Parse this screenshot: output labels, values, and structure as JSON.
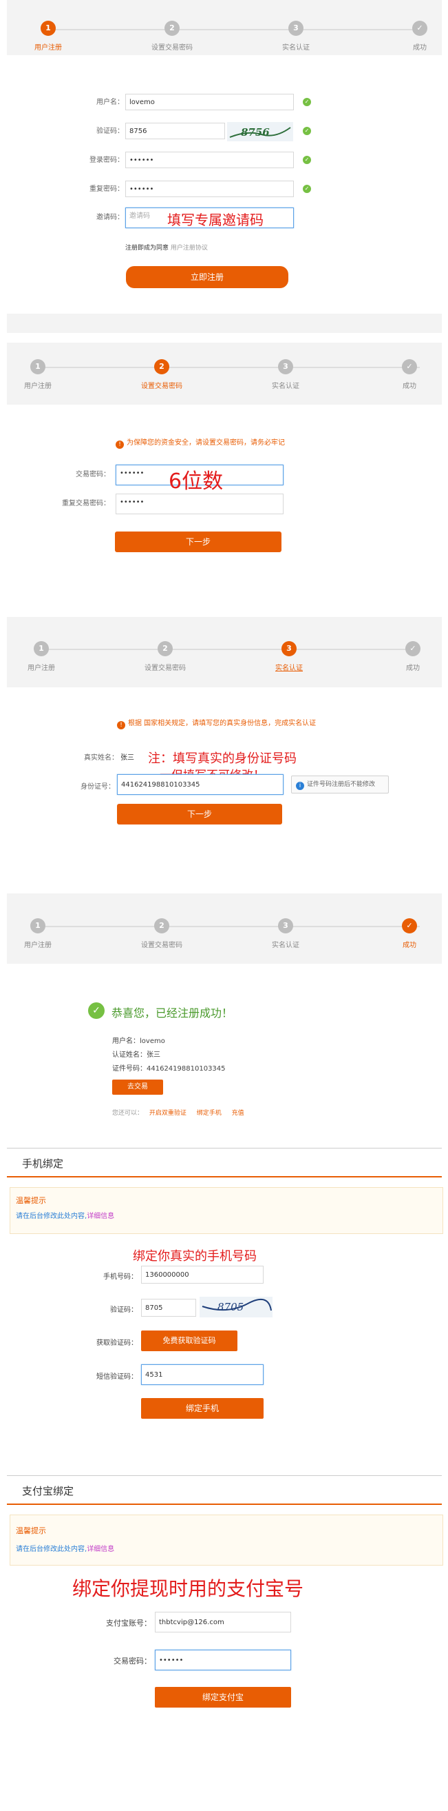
{
  "colors": {
    "accent": "#e85d04",
    "success": "#76c043",
    "note_red": "#e31c1c",
    "link_blue": "#2a7fd6"
  },
  "steps": {
    "s1": "1",
    "s2": "2",
    "s3": "3",
    "done_icon": "check-icon",
    "labels": [
      "用户注册",
      "设置交易密码",
      "实名认证",
      "成功"
    ]
  },
  "register": {
    "username_label": "用户名：",
    "username_value": "lovemo",
    "captcha_label": "验证码：",
    "captcha_value": "8756",
    "captcha_image_text": "8756",
    "password_label": "登录密码：",
    "password_value": "••••••",
    "repeat_label": "重复密码：",
    "repeat_value": "••••••",
    "invite_label": "邀请码：",
    "invite_placeholder": "邀请码",
    "invite_note": "填写专属邀请码",
    "agree_text": "注册即成为同意",
    "agree_link": "用户注册协议",
    "submit": "立即注册"
  },
  "trade_password": {
    "notice": "为保障您的资金安全，请设置交易密码，请务必牢记",
    "pwd_label": "交易密码：",
    "pwd_value": "••••••",
    "repeat_label": "重复交易密码：",
    "repeat_value": "••••••",
    "note": "6位数",
    "next": "下一步"
  },
  "realname": {
    "notice": "根据 国家相关规定，请填写您的真实身份信息，完成实名认证",
    "name_label": "真实姓名：",
    "name_value": "张三",
    "id_label": "身份证号：",
    "id_value": "441624198810103345",
    "note1": "注：填写真实的身份证号码",
    "note2": "一但填写不可修改！",
    "hint": "证件号码注册后不能修改",
    "next": "下一步"
  },
  "success": {
    "title": "恭喜您，已经注册成功！",
    "username": "用户名：lovemo",
    "auth_name": "认证姓名：张三",
    "id_number": "证件号码：441624198810103345",
    "go_trade": "去交易",
    "also_label": "您还可以：",
    "link1": "开启双重验证",
    "link2": "绑定手机",
    "link3": "充值"
  },
  "phone_bind": {
    "header": "手机绑定",
    "tip_title": "温馨提示",
    "tip_text": "请在后台修改此处内容,",
    "tip_link": "详细信息",
    "note": "绑定你真实的手机号码",
    "phone_label": "手机号码：",
    "phone_value": "1360000000",
    "captcha_label": "验证码：",
    "captcha_value": "8705",
    "captcha_image_text": "8705",
    "get_label": "获取验证码：",
    "get_button": "免费获取验证码",
    "sms_label": "短信验证码：",
    "sms_value": "4531",
    "submit": "绑定手机"
  },
  "alipay_bind": {
    "header": "支付宝绑定",
    "tip_title": "温馨提示",
    "tip_text": "请在后台修改此处内容,",
    "tip_link": "详细信息",
    "note": "绑定你提现时用的支付宝号",
    "account_label": "支付宝账号：",
    "account_value": "thbtcvip@126.com",
    "pwd_label": "交易密码：",
    "pwd_value": "••••••",
    "submit": "绑定支付宝"
  }
}
